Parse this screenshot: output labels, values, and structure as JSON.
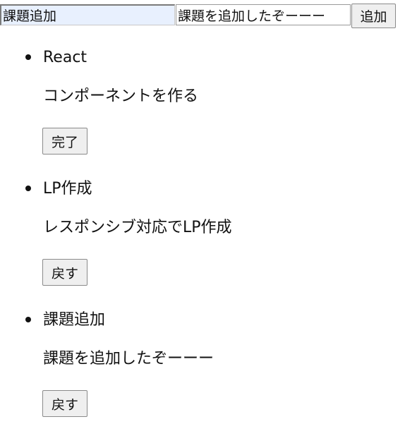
{
  "form": {
    "title_value": "課題追加",
    "description_value": "課題を追加したぞーーー",
    "add_button_label": "追加"
  },
  "todos": [
    {
      "title": "React",
      "description": "コンポーネントを作る",
      "button_label": "完了"
    },
    {
      "title": "LP作成",
      "description": "レスポンシブ対応でLP作成",
      "button_label": "戻す"
    },
    {
      "title": "課題追加",
      "description": "課題を追加したぞーーー",
      "button_label": "戻す"
    }
  ]
}
